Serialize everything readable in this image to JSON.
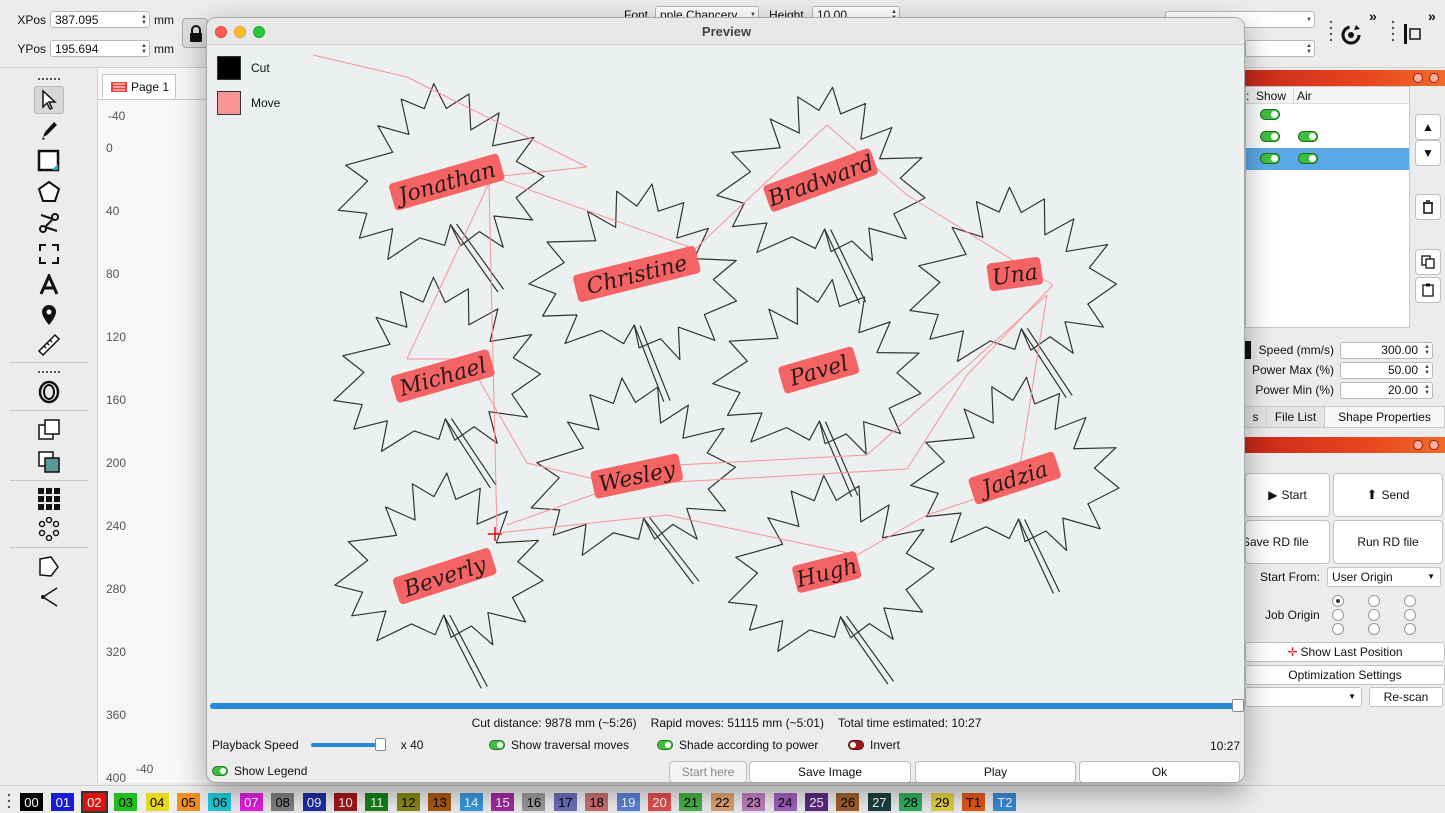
{
  "toolbar": {
    "xpos_label": "XPos",
    "xpos_value": "387.095",
    "ypos_label": "YPos",
    "ypos_value": "195.694",
    "unit": "mm",
    "font_label": "Font",
    "font_value": "pple Chancery",
    "height_label": "Height",
    "height_value": "10.00"
  },
  "canvas": {
    "page_tab": "Page 1",
    "ruler_top_left": "-40",
    "ruler_bottom": "-40",
    "ruler_left": [
      "0",
      "40",
      "80",
      "120",
      "160",
      "200",
      "240",
      "280",
      "320",
      "360",
      "400"
    ]
  },
  "preview": {
    "title": "Preview",
    "legend_cut": "Cut",
    "legend_move": "Move",
    "cut_color": "#000000",
    "move_color": "#f79595",
    "shade_color": "#f46464",
    "names": [
      "Jonathan",
      "Bradward",
      "Christine",
      "Una",
      "Michael",
      "Pavel",
      "Wesley",
      "Jadzia",
      "Beverly",
      "Hugh"
    ],
    "cut_distance": "Cut distance: 9878 mm (~5:26)",
    "rapid_moves": "Rapid moves: 51115 mm (~5:01)",
    "total_time": "Total time estimated: 10:27",
    "playback_speed_label": "Playback Speed",
    "playback_speed_value": "x 40",
    "playback_fraction": 0.93,
    "show_traversal": "Show traversal moves",
    "shade_power": "Shade according to power",
    "invert": "Invert",
    "time_right": "10:27",
    "show_legend": "Show Legend",
    "buttons": {
      "start_here": "Start here",
      "save_image": "Save Image",
      "play": "Play",
      "ok": "Ok"
    }
  },
  "right_panel": {
    "layer_headers": [
      "Show",
      "Air"
    ],
    "speed_label": "Speed (mm/s)",
    "speed_value": "300.00",
    "power_max_label": "Power Max (%)",
    "power_max_value": "50.00",
    "power_min_label": "Power Min (%)",
    "power_min_value": "20.00",
    "tab_partial": "s",
    "tab_file_list": "File List",
    "tab_shape_props": "Shape Properties",
    "start": "Start",
    "send": "Send",
    "save_rd": "Save RD file",
    "run_rd": "Run RD file",
    "start_from_label": "Start From:",
    "start_from_value": "User Origin",
    "job_origin_label": "Job Origin",
    "show_last_position": "Show Last Position",
    "optimization_settings": "Optimization Settings",
    "rescan": "Re-scan"
  },
  "palette": [
    {
      "label": "00",
      "bg": "#000000",
      "fg": "#ffffff"
    },
    {
      "label": "01",
      "bg": "#1b1bd6",
      "fg": "#ffffff"
    },
    {
      "label": "02",
      "bg": "#e01010",
      "fg": "#ffffff"
    },
    {
      "label": "03",
      "bg": "#1fbf1f",
      "fg": "#000000"
    },
    {
      "label": "04",
      "bg": "#e5d81f",
      "fg": "#000000"
    },
    {
      "label": "05",
      "bg": "#f09020",
      "fg": "#000000"
    },
    {
      "label": "06",
      "bg": "#20c8d8",
      "fg": "#000000"
    },
    {
      "label": "07",
      "bg": "#e020e0",
      "fg": "#ffffff"
    },
    {
      "label": "08",
      "bg": "#808080",
      "fg": "#000000"
    },
    {
      "label": "09",
      "bg": "#1f2f9f",
      "fg": "#ffffff"
    },
    {
      "label": "10",
      "bg": "#a01818",
      "fg": "#ffffff"
    },
    {
      "label": "11",
      "bg": "#15801a",
      "fg": "#ffffff"
    },
    {
      "label": "12",
      "bg": "#8a8a14",
      "fg": "#000000"
    },
    {
      "label": "13",
      "bg": "#a85a14",
      "fg": "#000000"
    },
    {
      "label": "14",
      "bg": "#3898e0",
      "fg": "#ffffff"
    },
    {
      "label": "15",
      "bg": "#a02aa0",
      "fg": "#ffffff"
    },
    {
      "label": "16",
      "bg": "#9a9a9a",
      "fg": "#000000"
    },
    {
      "label": "17",
      "bg": "#6a70b8",
      "fg": "#000000"
    },
    {
      "label": "18",
      "bg": "#c87070",
      "fg": "#000000"
    },
    {
      "label": "19",
      "bg": "#5a80d8",
      "fg": "#ffffff"
    },
    {
      "label": "20",
      "bg": "#e05050",
      "fg": "#ffffff"
    },
    {
      "label": "21",
      "bg": "#4ab04a",
      "fg": "#000000"
    },
    {
      "label": "22",
      "bg": "#e0a070",
      "fg": "#000000"
    },
    {
      "label": "23",
      "bg": "#c080c0",
      "fg": "#000000"
    },
    {
      "label": "24",
      "bg": "#a060c0",
      "fg": "#000000"
    },
    {
      "label": "25",
      "bg": "#5a2a80",
      "fg": "#ffffff"
    },
    {
      "label": "26",
      "bg": "#a06030",
      "fg": "#000000"
    },
    {
      "label": "27",
      "bg": "#1a4040",
      "fg": "#ffffff"
    },
    {
      "label": "28",
      "bg": "#30b060",
      "fg": "#000000"
    },
    {
      "label": "29",
      "bg": "#e0d040",
      "fg": "#000000"
    },
    {
      "label": "T1",
      "bg": "#e05818",
      "fg": "#000000"
    },
    {
      "label": "T2",
      "bg": "#3a8ad8",
      "fg": "#ffffff"
    }
  ]
}
